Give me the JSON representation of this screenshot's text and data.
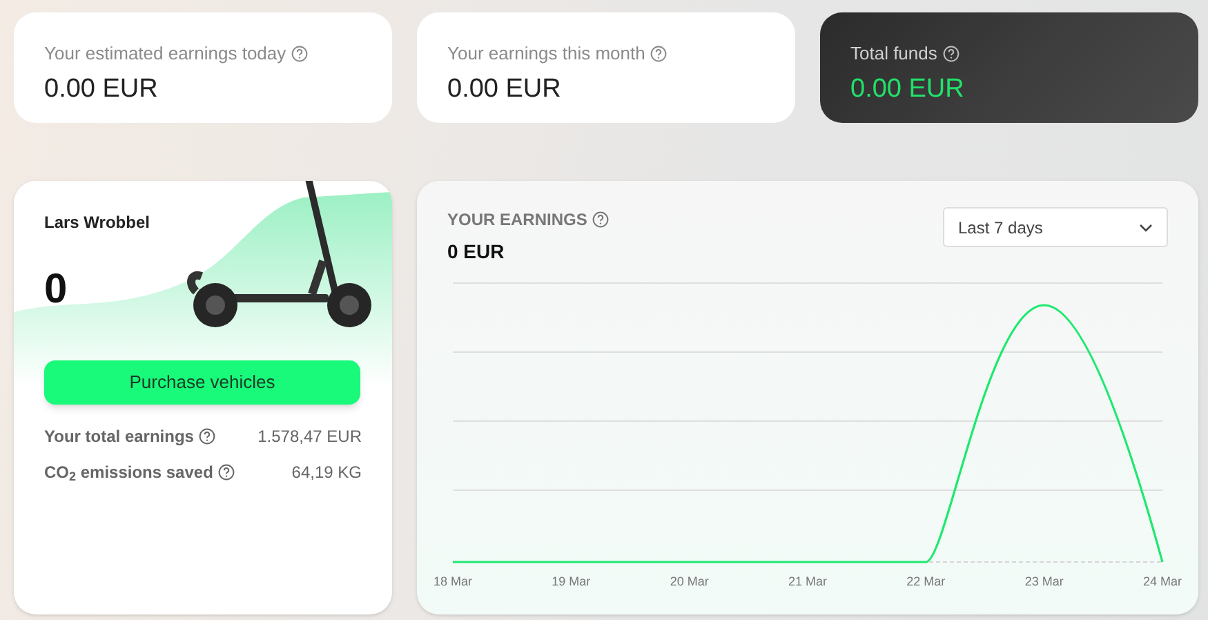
{
  "stat_cards": [
    {
      "label": "Your estimated earnings today",
      "value": "0.00 EUR",
      "kind": "light"
    },
    {
      "label": "Your earnings this month",
      "value": "0.00 EUR",
      "kind": "light"
    },
    {
      "label": "Total funds",
      "value": "0.00 EUR",
      "kind": "dark"
    }
  ],
  "vehicle_card": {
    "owner": "Lars Wrobbel",
    "vehicle_count": "0",
    "button": "Purchase vehicles",
    "stats": [
      {
        "label": "Your total earnings",
        "value": "1.578,47 EUR"
      },
      {
        "label": "CO$_{2}$ emissions saved",
        "value": "64,19 KG"
      }
    ]
  },
  "earnings_card": {
    "title": "YOUR EARNINGS",
    "total": "0 EUR",
    "period": "Last 7 days",
    "x_labels": [
      "18 Mar",
      "19 Mar",
      "20 Mar",
      "21 Mar",
      "22 Mar",
      "23 Mar",
      "24 Mar"
    ]
  }
}
